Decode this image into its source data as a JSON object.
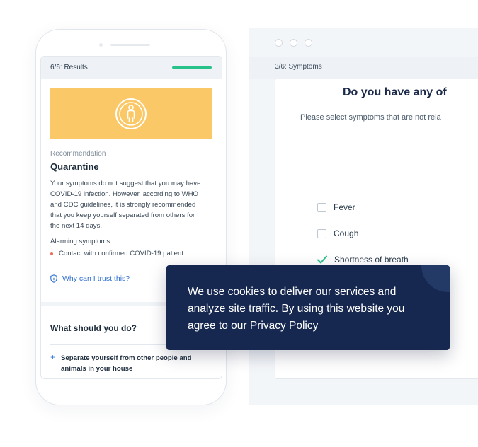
{
  "desktop": {
    "step_label": "3/6: Symptoms",
    "question": "Do you have any of",
    "subtitle": "Please select symptoms that are not rela",
    "symptoms": [
      {
        "label": "Fever",
        "checked": false
      },
      {
        "label": "Cough",
        "checked": false
      },
      {
        "label": "Shortness of breath",
        "checked": true
      }
    ]
  },
  "phone": {
    "step_label": "6/6: Results",
    "banner_icon": "person-in-circle-icon",
    "recommendation_label": "Recommendation",
    "recommendation_title": "Quarantine",
    "recommendation_text_lines": [
      "Your symptoms do not suggest that you may have",
      "COVID-19 infection. However, according to WHO",
      "and CDC guidelines, it is strongly recommended",
      "that you keep yourself separated from others for",
      "the next 14 days."
    ],
    "alarming_label": "Alarming symptoms:",
    "alarming_item": "Contact with confirmed COVID-19 patient",
    "trust_link": "Why can I trust this?",
    "what_title": "What should you do?",
    "what_item_lines": [
      "Separate yourself from other people and",
      "animals in your house"
    ]
  },
  "cookie": {
    "text": "We use cookies to deliver our services and analyze site traffic. By using this website you agree to our",
    "link": "Privacy Policy"
  },
  "colors": {
    "banner": "#fbc867",
    "progress": "#27c28a",
    "cookie_bg": "#16284f",
    "link": "#2f6fd1",
    "check": "#27c28a"
  }
}
